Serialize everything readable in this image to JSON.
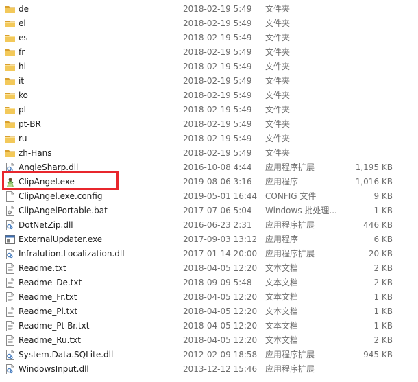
{
  "files": [
    {
      "name": "de",
      "date": "2018-02-19 5:49",
      "type": "文件夹",
      "size": "",
      "icon": "folder-icon"
    },
    {
      "name": "el",
      "date": "2018-02-19 5:49",
      "type": "文件夹",
      "size": "",
      "icon": "folder-icon"
    },
    {
      "name": "es",
      "date": "2018-02-19 5:49",
      "type": "文件夹",
      "size": "",
      "icon": "folder-icon"
    },
    {
      "name": "fr",
      "date": "2018-02-19 5:49",
      "type": "文件夹",
      "size": "",
      "icon": "folder-icon"
    },
    {
      "name": "hi",
      "date": "2018-02-19 5:49",
      "type": "文件夹",
      "size": "",
      "icon": "folder-icon"
    },
    {
      "name": "it",
      "date": "2018-02-19 5:49",
      "type": "文件夹",
      "size": "",
      "icon": "folder-icon"
    },
    {
      "name": "ko",
      "date": "2018-02-19 5:49",
      "type": "文件夹",
      "size": "",
      "icon": "folder-icon"
    },
    {
      "name": "pl",
      "date": "2018-02-19 5:49",
      "type": "文件夹",
      "size": "",
      "icon": "folder-icon"
    },
    {
      "name": "pt-BR",
      "date": "2018-02-19 5:49",
      "type": "文件夹",
      "size": "",
      "icon": "folder-icon"
    },
    {
      "name": "ru",
      "date": "2018-02-19 5:49",
      "type": "文件夹",
      "size": "",
      "icon": "folder-icon"
    },
    {
      "name": "zh-Hans",
      "date": "2018-02-19 5:49",
      "type": "文件夹",
      "size": "",
      "icon": "folder-icon"
    },
    {
      "name": "AngleSharp.dll",
      "date": "2016-10-08 4:44",
      "type": "应用程序扩展",
      "size": "1,195 KB",
      "icon": "dll-icon"
    },
    {
      "name": "ClipAngel.exe",
      "date": "2019-08-06 3:16",
      "type": "应用程序",
      "size": "1,016 KB",
      "icon": "clipangel-app-icon"
    },
    {
      "name": "ClipAngel.exe.config",
      "date": "2019-05-01 16:44",
      "type": "CONFIG 文件",
      "size": "9 KB",
      "icon": "file-icon"
    },
    {
      "name": "ClipAngelPortable.bat",
      "date": "2017-07-06 5:04",
      "type": "Windows 批处理...",
      "size": "1 KB",
      "icon": "bat-icon"
    },
    {
      "name": "DotNetZip.dll",
      "date": "2016-06-23 2:31",
      "type": "应用程序扩展",
      "size": "446 KB",
      "icon": "dll-icon"
    },
    {
      "name": "ExternalUpdater.exe",
      "date": "2017-09-03 13:12",
      "type": "应用程序",
      "size": "6 KB",
      "icon": "exe-icon"
    },
    {
      "name": "Infralution.Localization.dll",
      "date": "2017-01-14 20:00",
      "type": "应用程序扩展",
      "size": "20 KB",
      "icon": "dll-icon"
    },
    {
      "name": "Readme.txt",
      "date": "2018-04-05 12:20",
      "type": "文本文档",
      "size": "2 KB",
      "icon": "text-file-icon"
    },
    {
      "name": "Readme_De.txt",
      "date": "2018-09-09 5:48",
      "type": "文本文档",
      "size": "2 KB",
      "icon": "text-file-icon"
    },
    {
      "name": "Readme_Fr.txt",
      "date": "2018-04-05 12:20",
      "type": "文本文档",
      "size": "1 KB",
      "icon": "text-file-icon"
    },
    {
      "name": "Readme_Pl.txt",
      "date": "2018-04-05 12:20",
      "type": "文本文档",
      "size": "1 KB",
      "icon": "text-file-icon"
    },
    {
      "name": "Readme_Pt-Br.txt",
      "date": "2018-04-05 12:20",
      "type": "文本文档",
      "size": "1 KB",
      "icon": "text-file-icon"
    },
    {
      "name": "Readme_Ru.txt",
      "date": "2018-04-05 12:20",
      "type": "文本文档",
      "size": "2 KB",
      "icon": "text-file-icon"
    },
    {
      "name": "System.Data.SQLite.dll",
      "date": "2012-02-09 18:58",
      "type": "应用程序扩展",
      "size": "945 KB",
      "icon": "dll-icon"
    },
    {
      "name": "WindowsInput.dll",
      "date": "2013-12-12 15:46",
      "type": "应用程序扩展",
      "size": "",
      "icon": "dll-icon"
    }
  ],
  "highlight_color": "#e8262c",
  "folder_color": "#e8b43a"
}
